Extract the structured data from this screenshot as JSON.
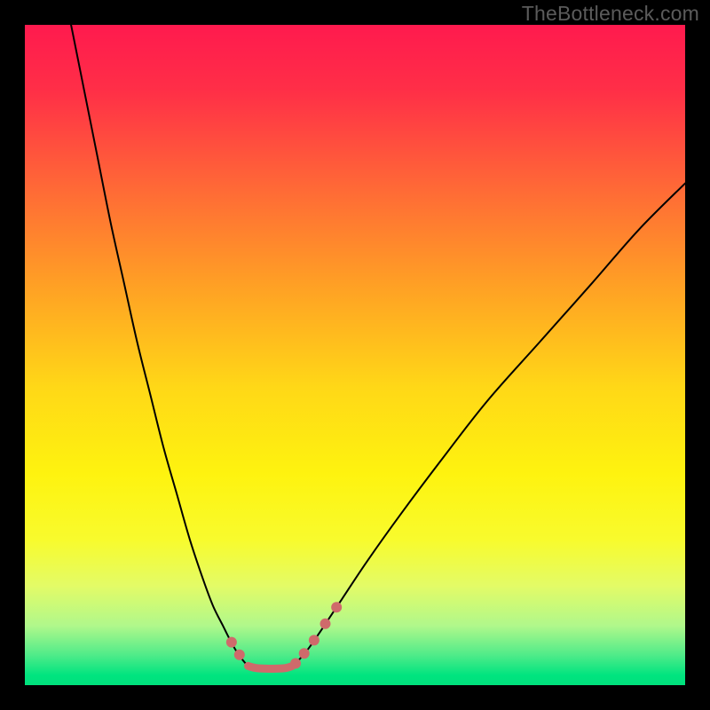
{
  "watermark": "TheBottleneck.com",
  "chart_data": {
    "type": "line",
    "title": "",
    "xlabel": "",
    "ylabel": "",
    "xlim": [
      0,
      100
    ],
    "ylim": [
      0,
      100
    ],
    "grid": false,
    "background_gradient": {
      "stops": [
        {
          "offset": 0.0,
          "color": "#ff1a4e"
        },
        {
          "offset": 0.1,
          "color": "#ff2f47"
        },
        {
          "offset": 0.25,
          "color": "#ff6a36"
        },
        {
          "offset": 0.4,
          "color": "#ffa224"
        },
        {
          "offset": 0.55,
          "color": "#ffd817"
        },
        {
          "offset": 0.68,
          "color": "#fef30f"
        },
        {
          "offset": 0.78,
          "color": "#f8fb2d"
        },
        {
          "offset": 0.85,
          "color": "#e3fb67"
        },
        {
          "offset": 0.91,
          "color": "#b0f88b"
        },
        {
          "offset": 0.955,
          "color": "#4eeb89"
        },
        {
          "offset": 0.985,
          "color": "#00e47f"
        },
        {
          "offset": 1.0,
          "color": "#00e07c"
        }
      ]
    },
    "series": [
      {
        "name": "curve-left",
        "stroke": "#000000",
        "stroke_width": 2,
        "x": [
          7,
          9,
          11,
          13,
          15,
          17,
          19,
          21,
          23,
          25,
          27,
          28.5,
          30,
          31,
          32,
          33,
          33.8
        ],
        "y": [
          100,
          90,
          80,
          70,
          61,
          52,
          44,
          36,
          29,
          22,
          16,
          12,
          9,
          7,
          5.2,
          3.8,
          2.9
        ]
      },
      {
        "name": "curve-right",
        "stroke": "#000000",
        "stroke_width": 2,
        "x": [
          40.5,
          41.5,
          43,
          45,
          48,
          52,
          57,
          63,
          70,
          78,
          86,
          93,
          100
        ],
        "y": [
          2.9,
          3.8,
          5.6,
          8.5,
          13,
          19,
          26,
          34,
          43,
          52,
          61,
          69,
          76
        ]
      },
      {
        "name": "ideal-flat",
        "stroke": "#cf6a6b",
        "stroke_width": 9,
        "x": [
          33.8,
          35,
          36.5,
          38,
          39.5,
          40.5
        ],
        "y": [
          2.9,
          2.6,
          2.5,
          2.5,
          2.6,
          2.9
        ]
      }
    ],
    "markers": [
      {
        "x": 31.3,
        "y": 6.5,
        "r": 6,
        "color": "#cf6a6b"
      },
      {
        "x": 32.5,
        "y": 4.6,
        "r": 6,
        "color": "#cf6a6b"
      },
      {
        "x": 41.0,
        "y": 3.3,
        "r": 6,
        "color": "#cf6a6b"
      },
      {
        "x": 42.3,
        "y": 4.8,
        "r": 6,
        "color": "#cf6a6b"
      },
      {
        "x": 43.8,
        "y": 6.8,
        "r": 6,
        "color": "#cf6a6b"
      },
      {
        "x": 45.5,
        "y": 9.3,
        "r": 6,
        "color": "#cf6a6b"
      },
      {
        "x": 47.2,
        "y": 11.8,
        "r": 6,
        "color": "#cf6a6b"
      }
    ]
  }
}
